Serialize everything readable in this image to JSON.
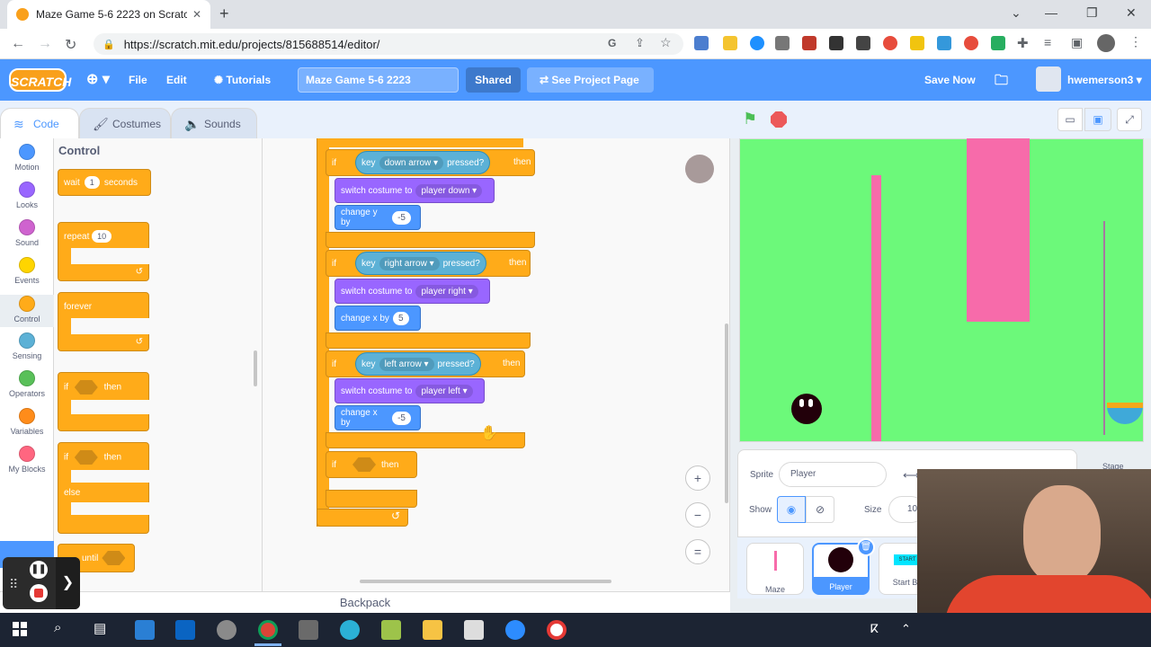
{
  "browser": {
    "tab_title": "Maze Game 5-6 2223 on Scratch",
    "url": "https://scratch.mit.edu/projects/815688514/editor/"
  },
  "menubar": {
    "logo": "SCRATCH",
    "file": "File",
    "edit": "Edit",
    "tutorials": "Tutorials",
    "project_title": "Maze Game 5-6 2223",
    "shared": "Shared",
    "see_project_page": "See Project Page",
    "save_now": "Save Now",
    "username": "hwemerson3"
  },
  "editor_tabs": {
    "code": "Code",
    "costumes": "Costumes",
    "sounds": "Sounds"
  },
  "categories": [
    {
      "label": "Motion",
      "color": "#4c97ff"
    },
    {
      "label": "Looks",
      "color": "#9966ff"
    },
    {
      "label": "Sound",
      "color": "#cf63cf"
    },
    {
      "label": "Events",
      "color": "#ffd500"
    },
    {
      "label": "Control",
      "color": "#ffab19"
    },
    {
      "label": "Sensing",
      "color": "#5cb1d6"
    },
    {
      "label": "Operators",
      "color": "#59c059"
    },
    {
      "label": "Variables",
      "color": "#ff8c1a"
    },
    {
      "label": "My Blocks",
      "color": "#ff6680"
    }
  ],
  "palette": {
    "heading": "Control",
    "wait": "wait",
    "wait_val": "1",
    "seconds": "seconds",
    "repeat": "repeat",
    "repeat_val": "10",
    "forever": "forever",
    "if1": "if",
    "then1": "then",
    "if2": "if",
    "then2": "then",
    "else": "else",
    "until": "until"
  },
  "script": {
    "if_label": "if",
    "key": "key",
    "pressed": "pressed?",
    "then": "then",
    "switch_costume": "switch costume to",
    "change_y": "change y by",
    "change_x": "change x by",
    "down": {
      "key": "down arrow",
      "costume": "player down",
      "value": "-5"
    },
    "right": {
      "key": "right arrow",
      "costume": "player right",
      "value": "5"
    },
    "left": {
      "key": "left arrow",
      "costume": "player left",
      "value": "-5"
    }
  },
  "zoom": {
    "in": "+",
    "out": "−",
    "reset": "="
  },
  "backpack": "Backpack",
  "sprite_info": {
    "sprite_label": "Sprite",
    "sprite_name": "Player",
    "show_label": "Show",
    "size_label": "Size",
    "size_value": "10",
    "stage_label": "Stage"
  },
  "sprites": [
    {
      "name": "Maze"
    },
    {
      "name": "Player"
    },
    {
      "name": "Start Bu"
    }
  ],
  "start_text": "START",
  "colors": {
    "scratch_blue": "#4c97ff",
    "control": "#ffab19",
    "stage_green": "#6cf97a",
    "wall_pink": "#f76baa"
  }
}
